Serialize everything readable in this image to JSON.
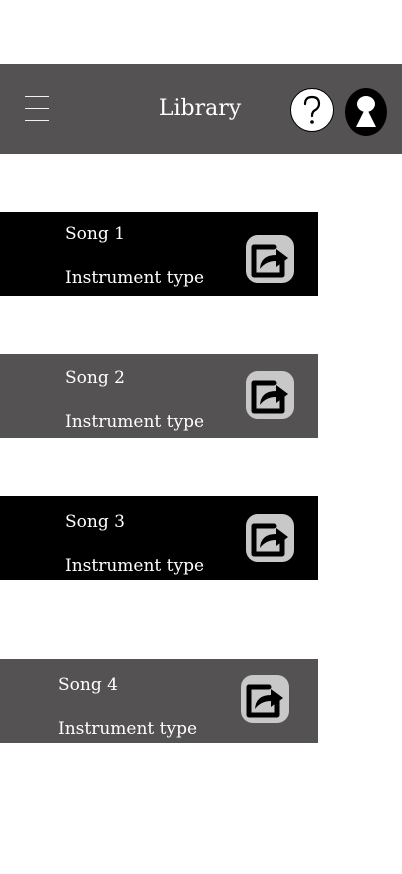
{
  "header": {
    "title": "Library",
    "menu_icon": "hamburger-menu-icon",
    "help_icon": "question-mark-icon",
    "profile_icon": "person-silhouette-icon",
    "background_color": "#545253"
  },
  "songs": [
    {
      "title": "Song 1",
      "instrument": "Instrument type",
      "share_icon": "share-icon",
      "theme": "dark"
    },
    {
      "title": "Song 2",
      "instrument": "Instrument type",
      "share_icon": "share-icon",
      "theme": "grey"
    },
    {
      "title": "Song 3",
      "instrument": "Instrument type",
      "share_icon": "share-icon",
      "theme": "dark"
    },
    {
      "title": "Song 4",
      "instrument": "Instrument type",
      "share_icon": "share-icon",
      "theme": "grey"
    }
  ],
  "colors": {
    "dark_card": "#000000",
    "grey_card": "#545253",
    "text": "#ffffff"
  }
}
